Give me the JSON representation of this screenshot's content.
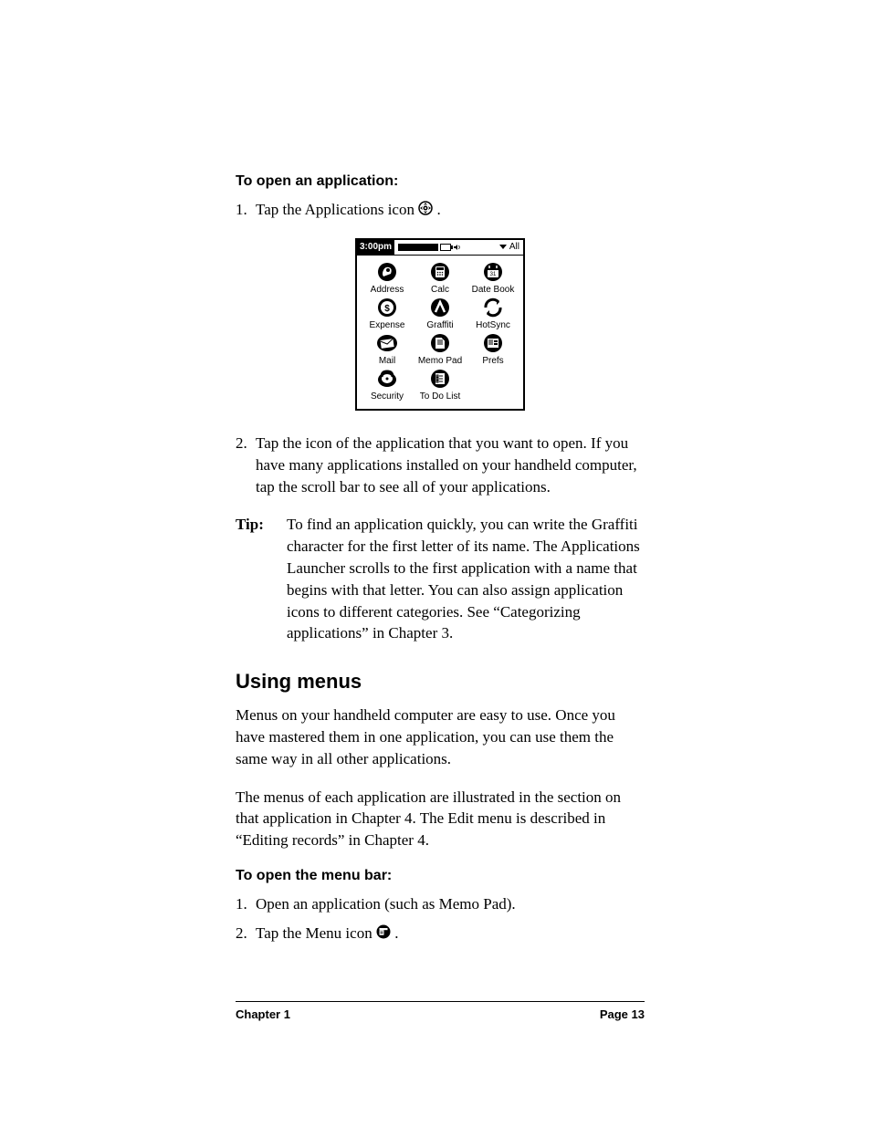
{
  "section1": {
    "heading": "To open an application:",
    "step1_num": "1.",
    "step1_text_a": "Tap the Applications icon ",
    "step1_text_b": ".",
    "step2_num": "2.",
    "step2_text": "Tap the icon of the application that you want to open. If you have many applications installed on your handheld computer, tap the scroll bar to see all of your applications."
  },
  "palm": {
    "time": "3:00pm",
    "category": "All",
    "apps": [
      {
        "label": "Address"
      },
      {
        "label": "Calc"
      },
      {
        "label": "Date Book"
      },
      {
        "label": "Expense"
      },
      {
        "label": "Graffiti"
      },
      {
        "label": "HotSync"
      },
      {
        "label": "Mail"
      },
      {
        "label": "Memo Pad"
      },
      {
        "label": "Prefs"
      },
      {
        "label": "Security"
      },
      {
        "label": "To Do List"
      }
    ]
  },
  "tip": {
    "label": "Tip:",
    "text": "To find an application quickly, you can write the Graffiti character for the first letter of its name. The Applications Launcher scrolls to the first application with a name that begins with that letter. You can also assign application icons to different categories. See “Categorizing applications” in Chapter 3."
  },
  "section2": {
    "heading": "Using menus",
    "para1": "Menus on your handheld computer are easy to use.  Once you have mastered them in one application, you can use them the same way in all other applications.",
    "para2": "The menus of each application are illustrated in the section on that application in Chapter 4. The Edit menu is described in “Editing records” in Chapter 4.",
    "sub_heading": "To open the menu bar:",
    "step1_num": "1.",
    "step1_text": "Open an application (such as Memo Pad).",
    "step2_num": "2.",
    "step2_text_a": "Tap the Menu icon ",
    "step2_text_b": "."
  },
  "footer": {
    "left": "Chapter 1",
    "right": "Page 13"
  }
}
